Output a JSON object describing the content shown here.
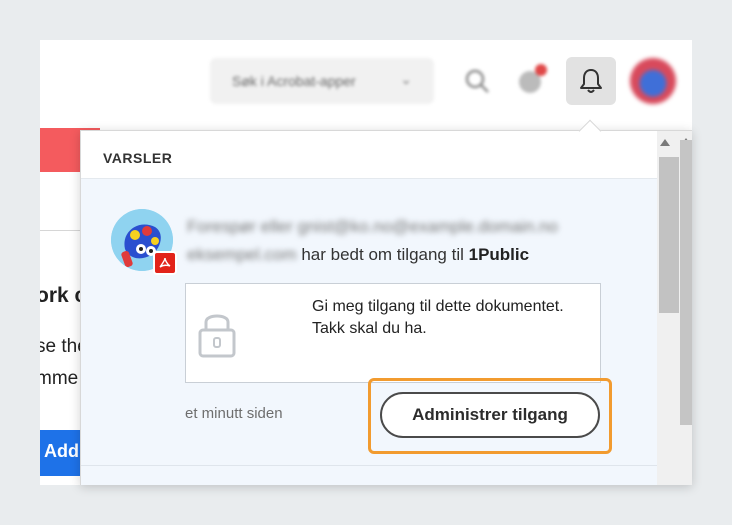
{
  "topbar": {
    "app_switcher_label": "Søk i Acrobat-apper",
    "search_icon": "search-icon",
    "apps_icon": "apps-icon",
    "bell_icon": "bell-icon"
  },
  "background": {
    "fragment_ork": "ork c",
    "fragment_se": "se the",
    "fragment_mme": "mme",
    "add_button": "Add"
  },
  "notifications": {
    "header": "VARSLER",
    "item": {
      "requester_name_blurred": "Forespør eller gnist@ko.no@example.domain.no",
      "requester_email_blurred": "eksempel.com",
      "request_text": "har bedt om tilgang til",
      "document_name": "1Public",
      "message_line1": "Gi meg tilgang til dette dokumentet.",
      "message_line2": "Takk skal du ha.",
      "time_ago": "et minutt siden",
      "manage_button": "Administrer tilgang",
      "badge_icon": "acrobat-pdf-icon",
      "lock_icon": "lock-icon"
    }
  },
  "colors": {
    "highlight": "#f29b2f",
    "accent_blue": "#1e72e8",
    "red_band": "#f45b5e",
    "pdf_red": "#e2231a"
  }
}
